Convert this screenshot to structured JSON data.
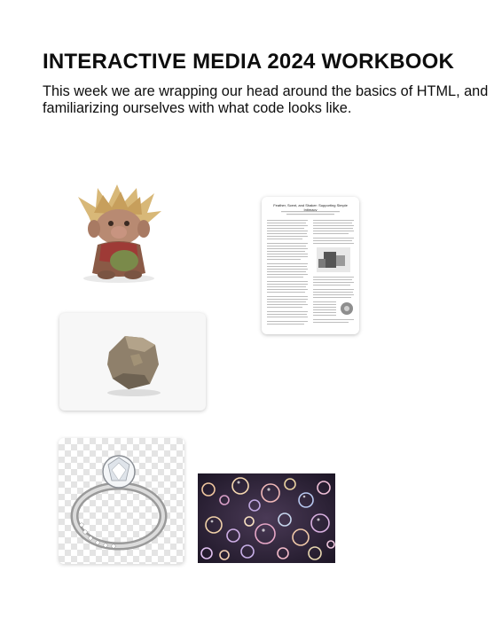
{
  "header": {
    "title": "INTERACTIVE MEDIA 2024 WORKBOOK",
    "intro": "This week we are wrapping our head around the basics of HTML, and familiarizing ourselves with what code looks like."
  },
  "gallery": {
    "paper": {
      "title": "Feather, Scent, and Shaker: Supporting Simple Intimacy"
    }
  },
  "colors": {
    "text": "#0d0d0d",
    "background": "#ffffff",
    "bubbles_bg": "#2a2036"
  }
}
